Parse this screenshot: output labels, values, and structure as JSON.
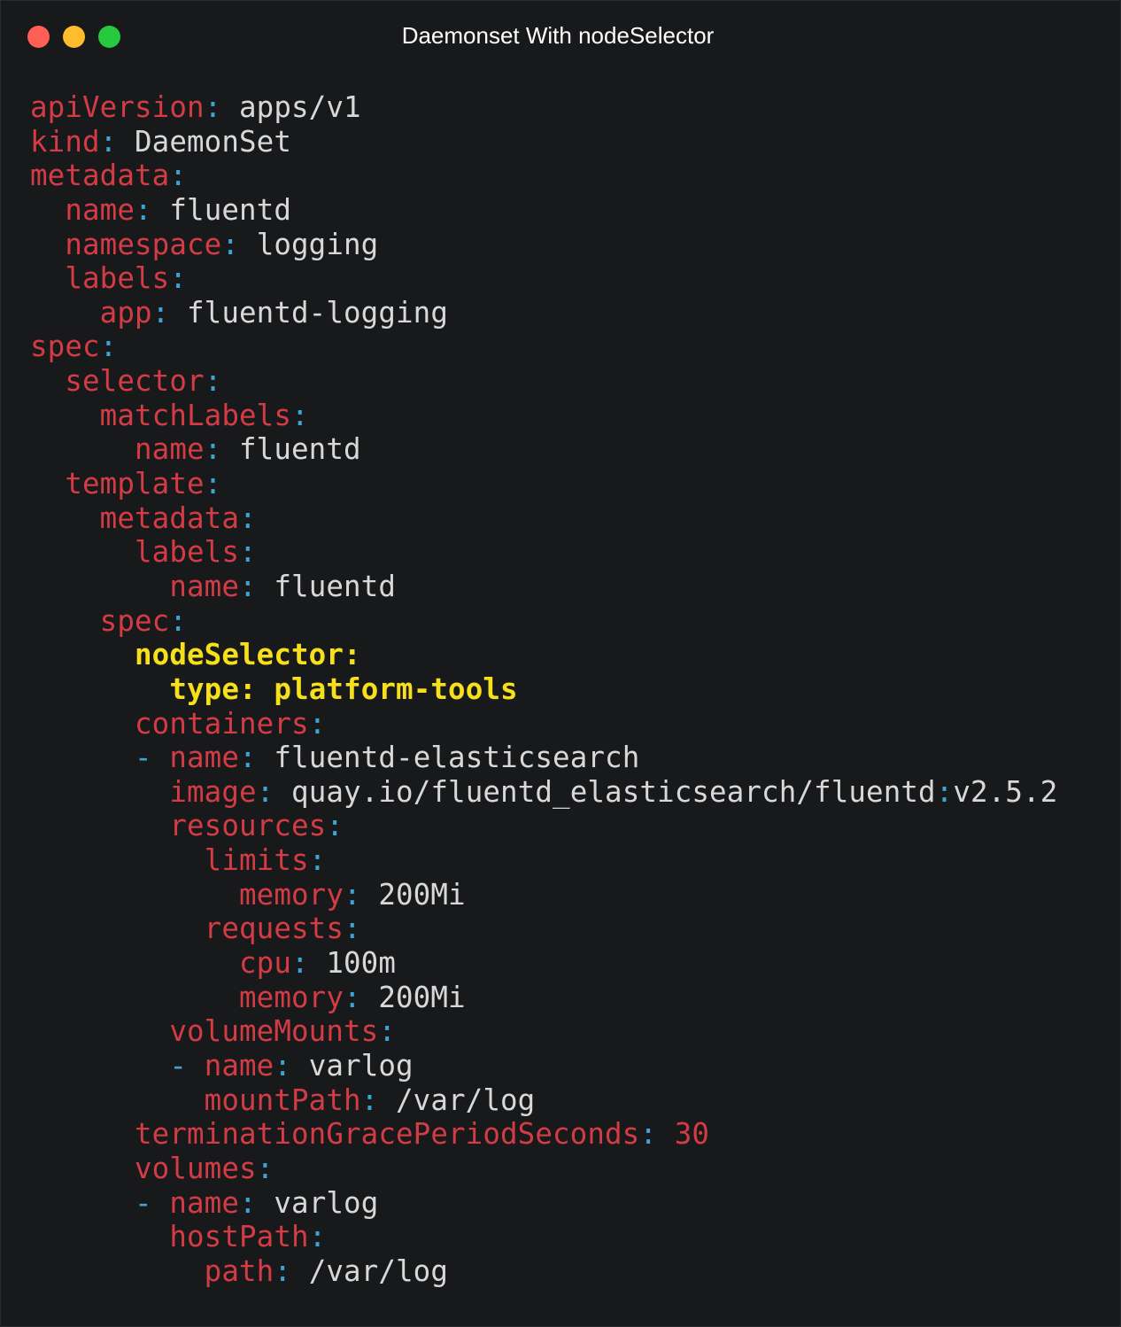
{
  "window": {
    "title": "Daemonset With nodeSelector",
    "controls": [
      {
        "name": "close",
        "color": "#ff5f56"
      },
      {
        "name": "minimize",
        "color": "#ffbd2e"
      },
      {
        "name": "maximize",
        "color": "#27c93f"
      }
    ]
  },
  "colors": {
    "background": "#18191b",
    "key": "#d33b45",
    "punctuation": "#3ea4d4",
    "value": "#d8d8d8",
    "highlight": "#f5e01b"
  },
  "code": {
    "language": "yaml",
    "lines": [
      {
        "indent": 0,
        "dash": false,
        "key": "apiVersion",
        "value": "apps/v1"
      },
      {
        "indent": 0,
        "dash": false,
        "key": "kind",
        "value": "DaemonSet"
      },
      {
        "indent": 0,
        "dash": false,
        "key": "metadata",
        "value": ""
      },
      {
        "indent": 1,
        "dash": false,
        "key": "name",
        "value": "fluentd"
      },
      {
        "indent": 1,
        "dash": false,
        "key": "namespace",
        "value": "logging"
      },
      {
        "indent": 1,
        "dash": false,
        "key": "labels",
        "value": ""
      },
      {
        "indent": 2,
        "dash": false,
        "key": "app",
        "value": "fluentd-logging"
      },
      {
        "indent": 0,
        "dash": false,
        "key": "spec",
        "value": ""
      },
      {
        "indent": 1,
        "dash": false,
        "key": "selector",
        "value": ""
      },
      {
        "indent": 2,
        "dash": false,
        "key": "matchLabels",
        "value": ""
      },
      {
        "indent": 3,
        "dash": false,
        "key": "name",
        "value": "fluentd"
      },
      {
        "indent": 1,
        "dash": false,
        "key": "template",
        "value": ""
      },
      {
        "indent": 2,
        "dash": false,
        "key": "metadata",
        "value": ""
      },
      {
        "indent": 3,
        "dash": false,
        "key": "labels",
        "value": ""
      },
      {
        "indent": 4,
        "dash": false,
        "key": "name",
        "value": "fluentd"
      },
      {
        "indent": 2,
        "dash": false,
        "key": "spec",
        "value": ""
      },
      {
        "indent": 3,
        "dash": false,
        "key": "nodeSelector",
        "value": "",
        "highlight": true
      },
      {
        "indent": 4,
        "dash": false,
        "key": "type",
        "value": "platform-tools",
        "highlight": true
      },
      {
        "indent": 3,
        "dash": false,
        "key": "containers",
        "value": ""
      },
      {
        "indent": 3,
        "dash": true,
        "key": "name",
        "value": "fluentd-elasticsearch"
      },
      {
        "indent": 4,
        "dash": false,
        "key": "image",
        "value": "quay.io/fluentd_elasticsearch/fluentd",
        "tag": "v2.5.2"
      },
      {
        "indent": 4,
        "dash": false,
        "key": "resources",
        "value": ""
      },
      {
        "indent": 5,
        "dash": false,
        "key": "limits",
        "value": ""
      },
      {
        "indent": 6,
        "dash": false,
        "key": "memory",
        "value": "200Mi"
      },
      {
        "indent": 5,
        "dash": false,
        "key": "requests",
        "value": ""
      },
      {
        "indent": 6,
        "dash": false,
        "key": "cpu",
        "value": "100m"
      },
      {
        "indent": 6,
        "dash": false,
        "key": "memory",
        "value": "200Mi"
      },
      {
        "indent": 4,
        "dash": false,
        "key": "volumeMounts",
        "value": ""
      },
      {
        "indent": 4,
        "dash": true,
        "key": "name",
        "value": "varlog"
      },
      {
        "indent": 5,
        "dash": false,
        "key": "mountPath",
        "value": "/var/log"
      },
      {
        "indent": 3,
        "dash": false,
        "key": "terminationGracePeriodSeconds",
        "value": "30",
        "numeric": true
      },
      {
        "indent": 3,
        "dash": false,
        "key": "volumes",
        "value": ""
      },
      {
        "indent": 3,
        "dash": true,
        "key": "name",
        "value": "varlog"
      },
      {
        "indent": 4,
        "dash": false,
        "key": "hostPath",
        "value": ""
      },
      {
        "indent": 5,
        "dash": false,
        "key": "path",
        "value": "/var/log"
      }
    ]
  }
}
